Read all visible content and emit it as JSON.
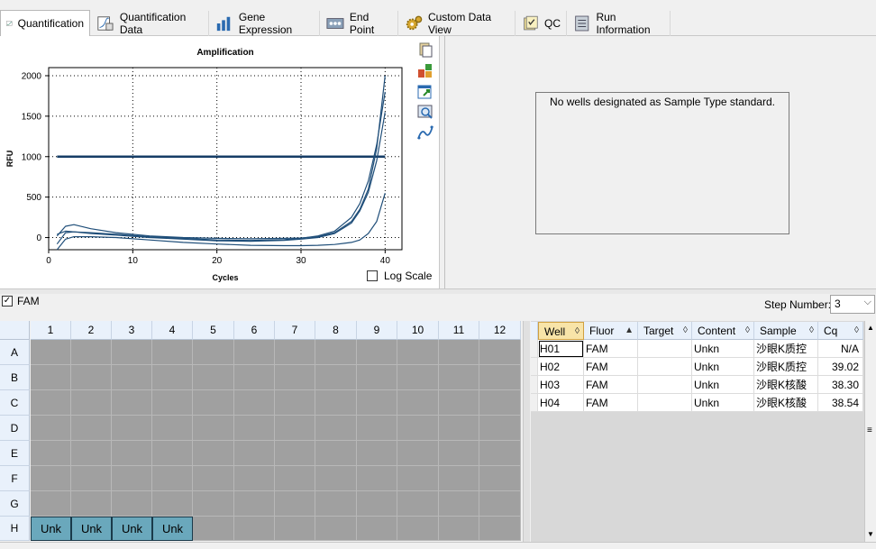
{
  "tabs": [
    {
      "label": "Quantification",
      "icon": "amplification-curve-icon",
      "active": true
    },
    {
      "label": "Quantification Data",
      "icon": "data-sheet-icon"
    },
    {
      "label": "Gene Expression",
      "icon": "bar-chart-icon"
    },
    {
      "label": "End Point",
      "icon": "end-point-icon"
    },
    {
      "label": "Custom Data View",
      "icon": "gear-cluster-icon"
    },
    {
      "label": "QC",
      "icon": "checklist-icon"
    },
    {
      "label": "Run Information",
      "icon": "document-icon"
    }
  ],
  "chart_data": {
    "type": "line",
    "title": "Amplification",
    "xlabel": "Cycles",
    "ylabel": "RFU",
    "xlim": [
      0,
      42
    ],
    "ylim": [
      -150,
      2100
    ],
    "xticks": [
      "0",
      "10",
      "20",
      "30",
      "40"
    ],
    "yticks": [
      "0",
      "500",
      "1000",
      "1500",
      "2000"
    ],
    "grid": "dotted",
    "threshold": 1000,
    "series": [
      {
        "values": [
          [
            1,
            20
          ],
          [
            2,
            140
          ],
          [
            3,
            160
          ],
          [
            5,
            110
          ],
          [
            8,
            60
          ],
          [
            12,
            20
          ],
          [
            16,
            0
          ],
          [
            20,
            -10
          ],
          [
            24,
            -15
          ],
          [
            28,
            -10
          ],
          [
            30,
            -5
          ],
          [
            32,
            10
          ],
          [
            34,
            60
          ],
          [
            36,
            200
          ],
          [
            37,
            350
          ],
          [
            38,
            600
          ],
          [
            39,
            1100
          ],
          [
            40,
            2000
          ]
        ]
      },
      {
        "values": [
          [
            1,
            -80
          ],
          [
            2,
            60
          ],
          [
            3,
            70
          ],
          [
            5,
            60
          ],
          [
            8,
            40
          ],
          [
            12,
            10
          ],
          [
            16,
            -10
          ],
          [
            20,
            -30
          ],
          [
            24,
            -35
          ],
          [
            28,
            -25
          ],
          [
            30,
            -10
          ],
          [
            32,
            20
          ],
          [
            34,
            80
          ],
          [
            36,
            250
          ],
          [
            37,
            420
          ],
          [
            38,
            700
          ],
          [
            39,
            1150
          ],
          [
            40,
            1800
          ]
        ]
      },
      {
        "values": [
          [
            1,
            40
          ],
          [
            2,
            80
          ],
          [
            3,
            70
          ],
          [
            5,
            50
          ],
          [
            8,
            30
          ],
          [
            12,
            0
          ],
          [
            16,
            -20
          ],
          [
            20,
            -40
          ],
          [
            24,
            -45
          ],
          [
            28,
            -35
          ],
          [
            30,
            -20
          ],
          [
            32,
            0
          ],
          [
            34,
            50
          ],
          [
            36,
            180
          ],
          [
            37,
            330
          ],
          [
            38,
            560
          ],
          [
            39,
            950
          ],
          [
            40,
            1550
          ]
        ]
      },
      {
        "values": [
          [
            1,
            -150
          ],
          [
            2,
            -20
          ],
          [
            3,
            10
          ],
          [
            5,
            10
          ],
          [
            8,
            0
          ],
          [
            12,
            -30
          ],
          [
            16,
            -60
          ],
          [
            20,
            -80
          ],
          [
            24,
            -95
          ],
          [
            28,
            -100
          ],
          [
            30,
            -100
          ],
          [
            32,
            -95
          ],
          [
            34,
            -85
          ],
          [
            36,
            -60
          ],
          [
            37,
            -30
          ],
          [
            38,
            50
          ],
          [
            39,
            200
          ],
          [
            40,
            550
          ]
        ]
      }
    ]
  },
  "chart": {
    "log_scale_label": "Log Scale",
    "log_scale_checked": false,
    "side_icons": [
      "copy-icon",
      "colors-icon",
      "export-icon",
      "zoom-icon",
      "curve-icon"
    ]
  },
  "standard": {
    "message": "No wells designated as Sample Type standard."
  },
  "fluor": {
    "label": "FAM",
    "checked": true
  },
  "step": {
    "label": "Step Number:",
    "value": "3"
  },
  "plate": {
    "columns": [
      "1",
      "2",
      "3",
      "4",
      "5",
      "6",
      "7",
      "8",
      "9",
      "10",
      "11",
      "12"
    ],
    "rows": [
      "A",
      "B",
      "C",
      "D",
      "E",
      "F",
      "G",
      "H"
    ],
    "unk_label": "Unk",
    "unk_wells": [
      "H1",
      "H2",
      "H3",
      "H4"
    ]
  },
  "table": {
    "headers": [
      "Well",
      "Fluor",
      "Target",
      "Content",
      "Sample",
      "Cq"
    ],
    "rows": [
      {
        "well": "H01",
        "fluor": "FAM",
        "target": "",
        "content": "Unkn",
        "sample": "沙眼K质控",
        "cq": "N/A"
      },
      {
        "well": "H02",
        "fluor": "FAM",
        "target": "",
        "content": "Unkn",
        "sample": "沙眼K质控",
        "cq": "39.02"
      },
      {
        "well": "H03",
        "fluor": "FAM",
        "target": "",
        "content": "Unkn",
        "sample": "沙眼K核酸",
        "cq": "38.30"
      },
      {
        "well": "H04",
        "fluor": "FAM",
        "target": "",
        "content": "Unkn",
        "sample": "沙眼K核酸",
        "cq": "38.54"
      }
    ]
  },
  "colors": {
    "curve": "#1f4e79",
    "threshold": "#163d66",
    "unk_well": "#6aa8bc",
    "empty_well": "#a0a0a0"
  }
}
